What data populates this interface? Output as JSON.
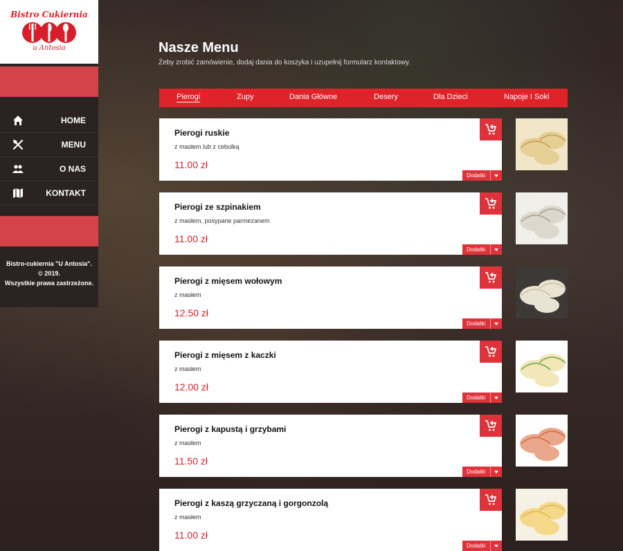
{
  "brand": {
    "line1": "Bistro Cukiernia",
    "line2": "u Antosia"
  },
  "nav": [
    {
      "label": "HOME",
      "icon": "home-icon"
    },
    {
      "label": "MENU",
      "icon": "utensils-icon"
    },
    {
      "label": "O NAS",
      "icon": "people-icon"
    },
    {
      "label": "KONTAKT",
      "icon": "map-icon"
    }
  ],
  "footer": {
    "line1": "Bistro-cukiernia \"U Antosia\".",
    "line2": "© 2019.",
    "line3": "Wszystkie prawa zastrzeżone."
  },
  "header": {
    "title": "Nasze Menu",
    "subtitle": "Żeby zrobić zamówienie, dodaj dania do koszyka i uzupełnij formularz kontaktowy."
  },
  "tabs": [
    {
      "label": "Pierogi",
      "active": true
    },
    {
      "label": "Zupy"
    },
    {
      "label": "Dania Główne"
    },
    {
      "label": "Desery"
    },
    {
      "label": "Dla Dzieci"
    },
    {
      "label": "Napoje I Soki"
    }
  ],
  "items": [
    {
      "name": "Pierogi ruskie",
      "desc": "z masłem lub z cebulką",
      "price": "11.00 zł",
      "extras": "Dodatki"
    },
    {
      "name": "Pierogi ze szpinakiem",
      "desc": "z masłem, posypane parmezanem",
      "price": "11.00 zł",
      "extras": "Dodatki"
    },
    {
      "name": "Pierogi z mięsem wołowym",
      "desc": "z masłem",
      "price": "12.50 zł",
      "extras": "Dodatki"
    },
    {
      "name": "Pierogi z mięsem z kaczki",
      "desc": "z masłem",
      "price": "12.00 zł",
      "extras": "Dodatki"
    },
    {
      "name": "Pierogi z kapustą i grzybami",
      "desc": "z masłem",
      "price": "11.50 zł",
      "extras": "Dodatki"
    },
    {
      "name": "Pierogi z kaszą grzyczaną i gorgonzolą",
      "desc": "z masłem",
      "price": "11.00 zł",
      "extras": "Dodatki"
    }
  ],
  "colors": {
    "accent": "#e0232b",
    "sidebar": "#2a2322",
    "price": "#d4202a"
  }
}
